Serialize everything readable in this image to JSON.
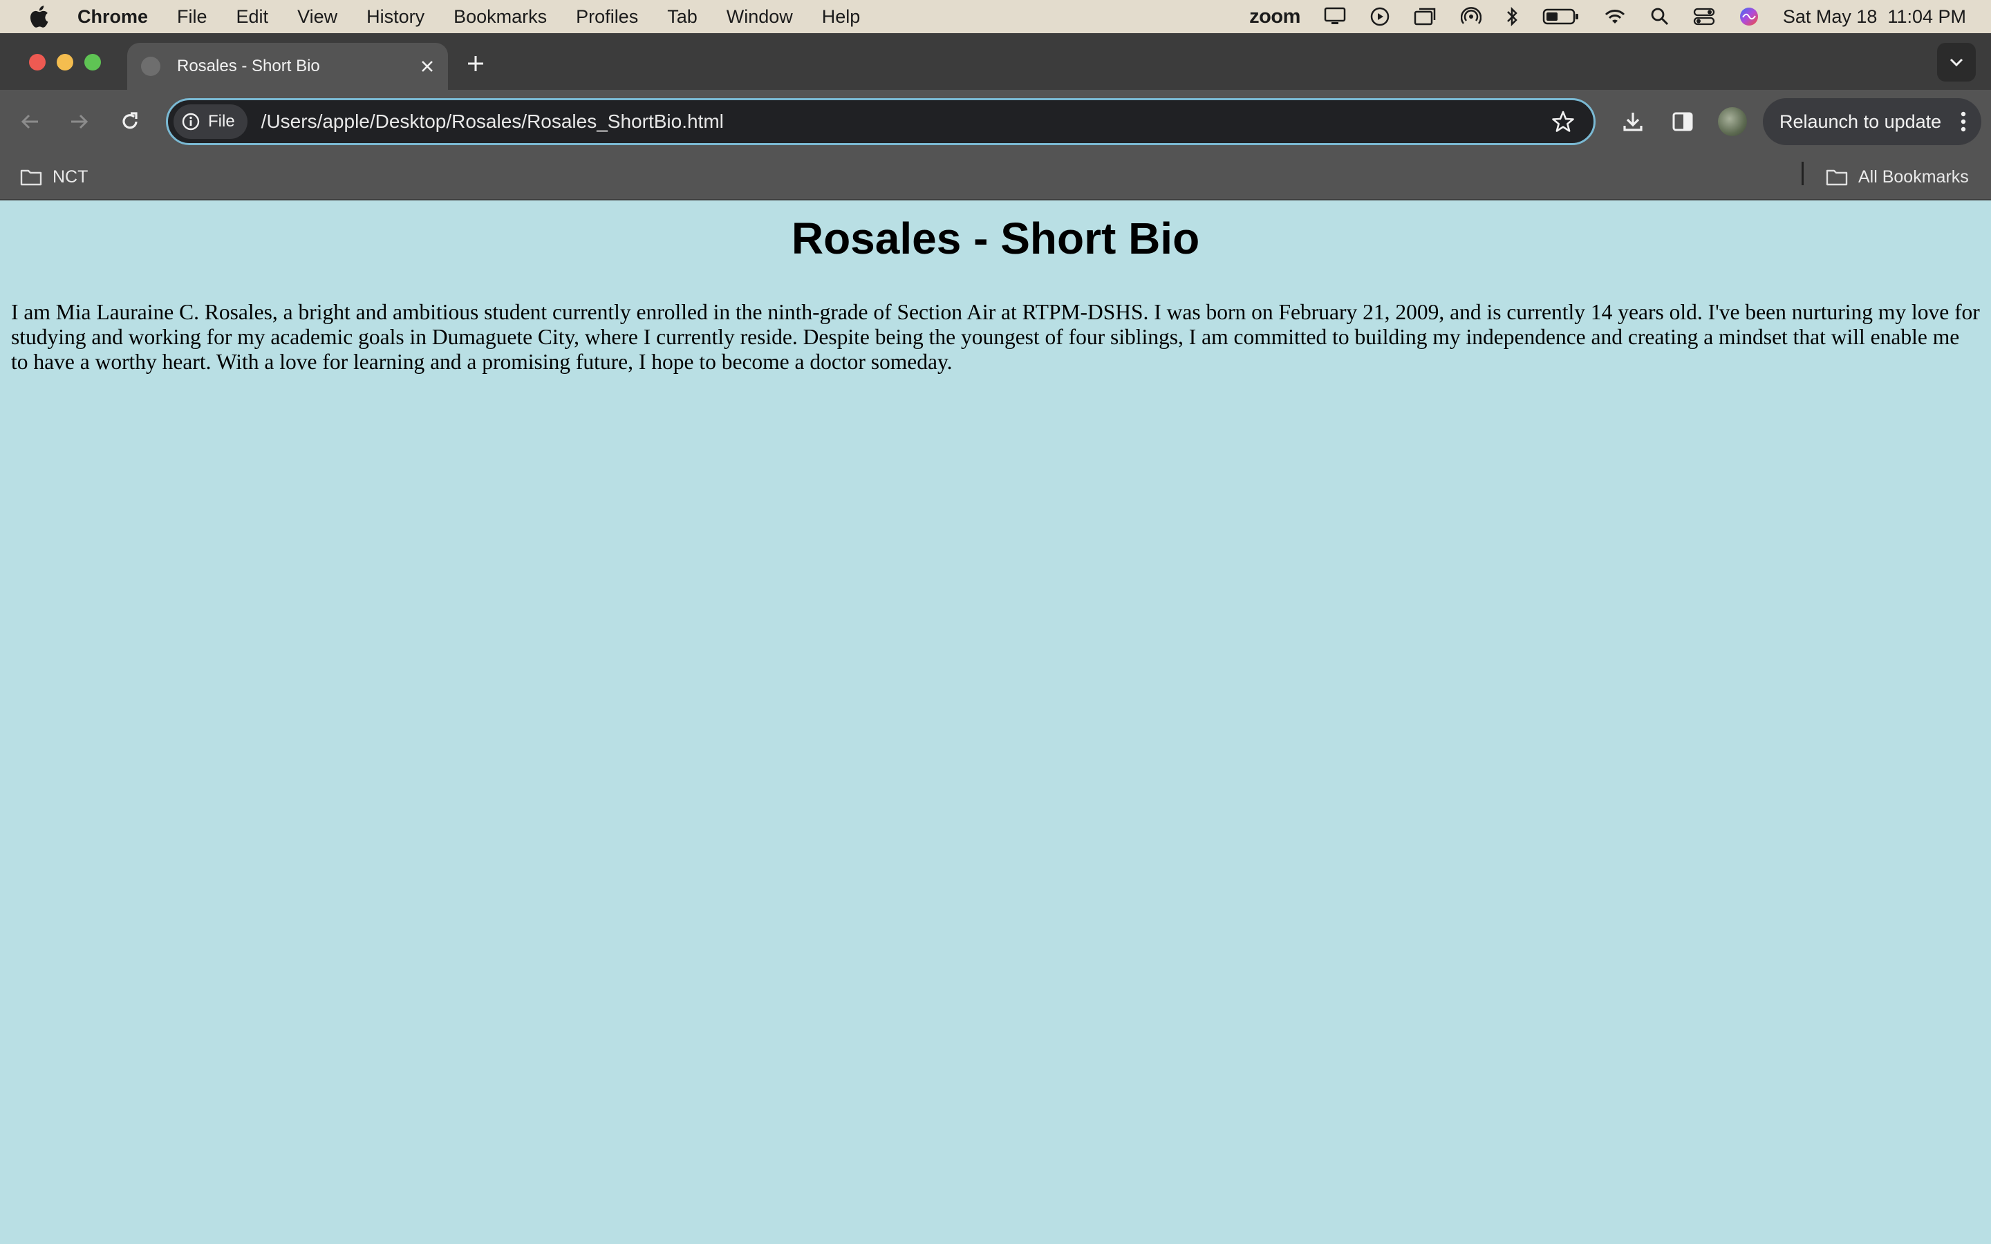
{
  "menubar": {
    "app": "Chrome",
    "items": [
      "File",
      "Edit",
      "View",
      "History",
      "Bookmarks",
      "Profiles",
      "Tab",
      "Window",
      "Help"
    ],
    "zoom": "zoom",
    "datetime": "Sat May 18  11:04 PM"
  },
  "tab": {
    "title": "Rosales - Short Bio"
  },
  "omnibox": {
    "chip_label": "File",
    "url": "/Users/apple/Desktop/Rosales/Rosales_ShortBio.html"
  },
  "toolbar": {
    "relaunch_label": "Relaunch to update"
  },
  "bookmarks": {
    "folder": "NCT",
    "all": "All Bookmarks"
  },
  "page": {
    "title": "Rosales - Short Bio",
    "paragraph": "I am Mia Lauraine C. Rosales, a bright and ambitious student currently enrolled in the ninth-grade of Section Air at RTPM-DSHS. I was born on February 21, 2009, and is currently 14 years old. I've been nurturing my love for studying and working for my academic goals in Dumaguete City, where I currently reside. Despite being the youngest of four siblings, I am committed to building my independence and creating a mindset that will enable me to have a worthy heart. With a love for learning and a promising future, I hope to become a doctor someday."
  },
  "colors": {
    "page_background": "#b9dfe4",
    "omnibox_focus": "#7ab9d3",
    "chrome_dark": "#3c3c3c"
  }
}
